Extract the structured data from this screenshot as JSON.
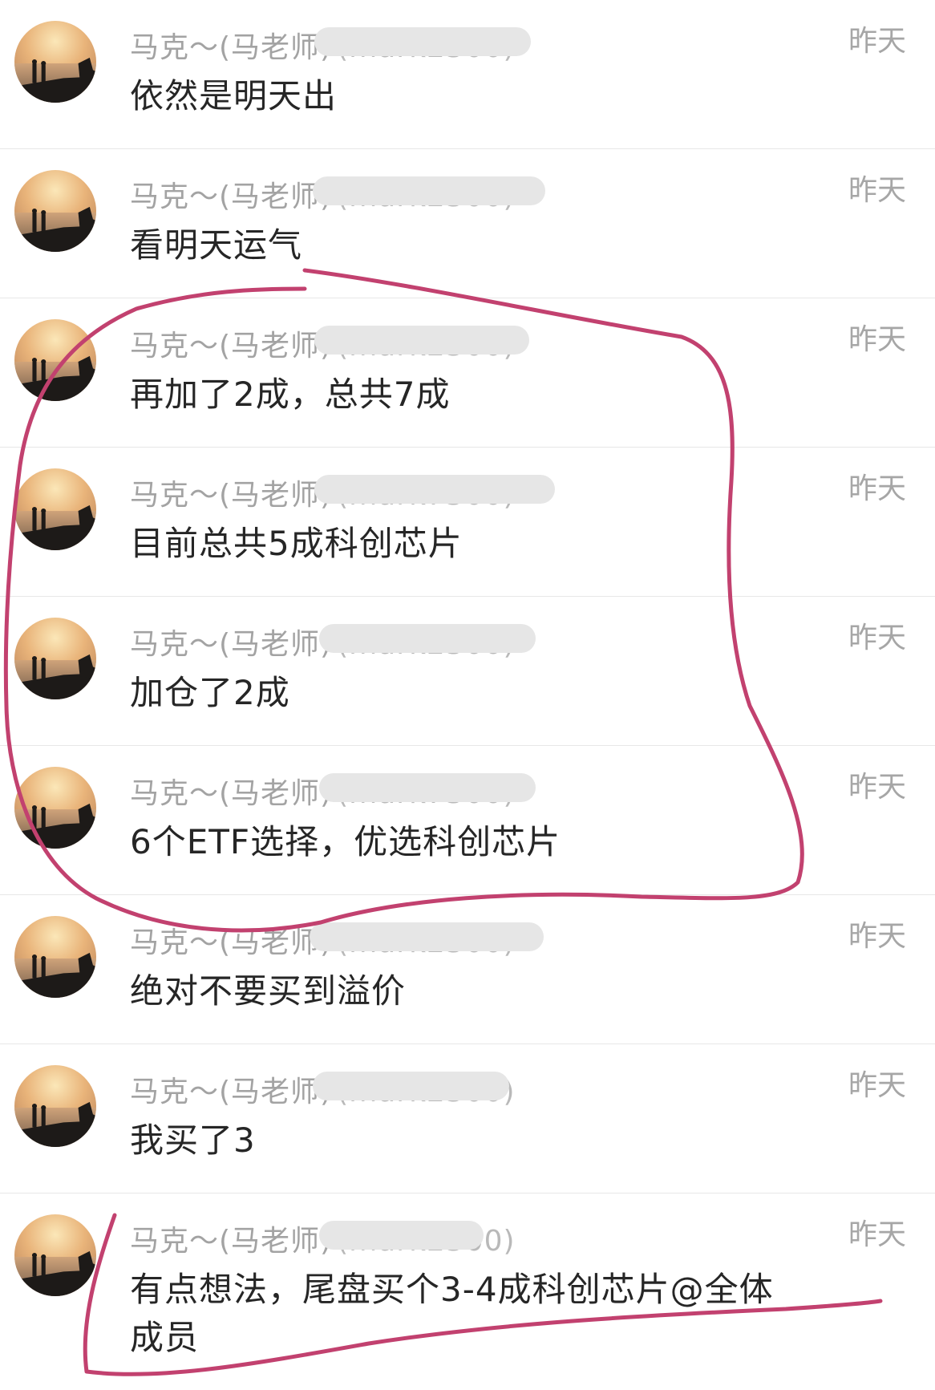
{
  "messages": [
    {
      "sender": "马克～(马老师)",
      "handle": "(mark2500)",
      "time": "昨天",
      "text": "依然是明天出"
    },
    {
      "sender": "马克～(马老师)",
      "handle": "(mark2500)",
      "time": "昨天",
      "text": "看明天运气"
    },
    {
      "sender": "马克～(马老师)",
      "handle": "(mark2500)",
      "time": "昨天",
      "text": "再加了2成，总共7成"
    },
    {
      "sender": "马克～(马老师)",
      "handle": "(mark7500)",
      "time": "昨天",
      "text": "目前总共5成科创芯片"
    },
    {
      "sender": "马克～(马老师)",
      "handle": "(mark2500)",
      "time": "昨天",
      "text": "加仓了2成"
    },
    {
      "sender": "马克～(马老师)",
      "handle": "(mark7500)",
      "time": "昨天",
      "text": "6个ETF选择，优选科创芯片"
    },
    {
      "sender": "马克～(马老师)",
      "handle": "(mark2500)",
      "time": "昨天",
      "text": "绝对不要买到溢价"
    },
    {
      "sender": "马克～(马老师)",
      "handle": "(mark2500)",
      "time": "昨天",
      "text": "我买了3"
    },
    {
      "sender": "马克～(马老师)",
      "handle": "(mark2500)",
      "time": "昨天",
      "text": "有点想法，尾盘买个3-4成科创芯片@全体成员"
    }
  ],
  "annotation_color": "#c2416f",
  "avatar_icon": "sunset-couple-avatar-icon"
}
